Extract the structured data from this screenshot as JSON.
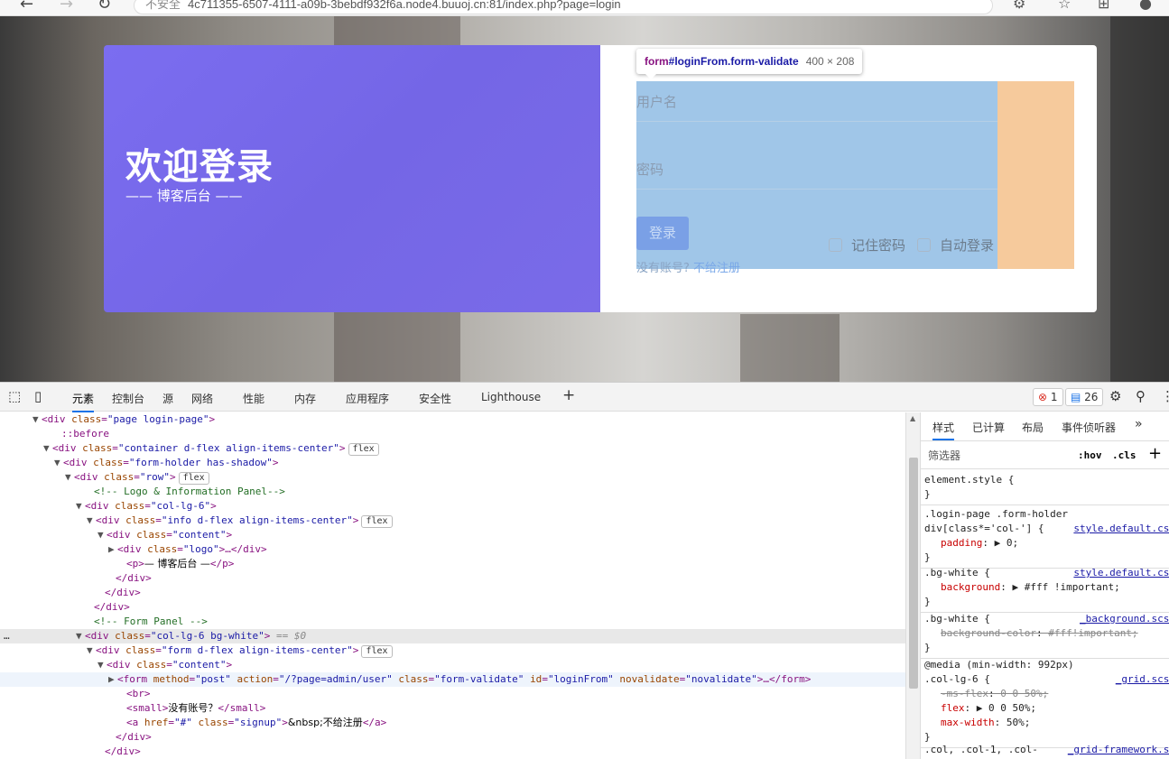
{
  "browser": {
    "back_icon": "←",
    "forward_icon": "→",
    "reload_icon": "↻",
    "security_label": "不安全",
    "url": "4c711355-6507-4111-a09b-3bebdf932f6a.node4.buuoj.cn:81/index.php?page=login"
  },
  "page": {
    "title": "欢迎登录",
    "subtitle": "—— 博客后台 ——",
    "username_placeholder": "用户名",
    "password_placeholder": "密码",
    "login_button": "登录",
    "remember_label": "记住密码",
    "autologin_label": "自动登录",
    "no_account": "没有账号?",
    "signup_link": "不给注册"
  },
  "tooltip": {
    "tag": "form",
    "selector": "#loginFrom.form-validate",
    "size": "400 × 208"
  },
  "devtools": {
    "tabs": [
      "元素",
      "控制台",
      "源",
      "网络",
      "性能",
      "内存",
      "应用程序",
      "安全性",
      "Lighthouse"
    ],
    "error_count": "1",
    "message_count": "26",
    "styles_tabs": [
      "样式",
      "已计算",
      "布局",
      "事件侦听器"
    ],
    "filter_placeholder": "筛选器",
    "hov": ":hov",
    "cls": ".cls",
    "dom_lines": [
      {
        "prefix": "▼",
        "t1": "<div ",
        "an": "class",
        "av": "\"page login-page\"",
        "t2": ">"
      },
      {
        "prefix": "",
        "ps": "::before"
      },
      {
        "prefix": "▼",
        "t1": "<div ",
        "an": "class",
        "av": "\"container d-flex align-items-center\"",
        "t2": ">",
        "flex": "flex"
      },
      {
        "prefix": "▼",
        "t1": "<div ",
        "an": "class",
        "av": "\"form-holder has-shadow\"",
        "t2": ">"
      },
      {
        "prefix": "▼",
        "t1": "<div ",
        "an": "class",
        "av": "\"row\"",
        "t2": ">",
        "flex": "flex"
      },
      {
        "prefix": "",
        "cm": "<!-- Logo & Information Panel-->"
      },
      {
        "prefix": "▼",
        "t1": "<div ",
        "an": "class",
        "av": "\"col-lg-6\"",
        "t2": ">"
      },
      {
        "prefix": "▼",
        "t1": "<div ",
        "an": "class",
        "av": "\"info d-flex align-items-center\"",
        "t2": ">",
        "flex": "flex"
      },
      {
        "prefix": "▼",
        "t1": "<div ",
        "an": "class",
        "av": "\"content\"",
        "t2": ">"
      },
      {
        "prefix": "▶",
        "t1": "<div ",
        "an": "class",
        "av": "\"logo\"",
        "t2": ">…</div>"
      },
      {
        "prefix": "",
        "t1": "<p>",
        "tx": "— 博客后台 —",
        "t2": "</p>"
      },
      {
        "prefix": "",
        "t1": "</div>"
      },
      {
        "prefix": "",
        "t1": "</div>"
      },
      {
        "prefix": "",
        "t1": "</div>"
      },
      {
        "prefix": "",
        "cm": "<!-- Form Panel    -->"
      },
      {
        "prefix": "▼",
        "t1": "<div ",
        "an": "class",
        "av": "\"col-lg-6 bg-white\"",
        "t2": ">",
        "eq": " == $0"
      },
      {
        "prefix": "▼",
        "t1": "<div ",
        "an": "class",
        "av": "\"form d-flex align-items-center\"",
        "t2": ">",
        "flex": "flex"
      },
      {
        "prefix": "▼",
        "t1": "<div ",
        "an": "class",
        "av": "\"content\"",
        "t2": ">"
      },
      {
        "prefix": "▶",
        "t1": "<form ",
        "an": "method",
        "av": "\"post\"",
        "an2": "action",
        "av2": "\"/?page=admin/user\"",
        "an3": "class",
        "av3": "\"form-validate\"",
        "an4": "id",
        "av4": "\"loginFrom\"",
        "an5": "novalidate",
        "av5": "\"novalidate\"",
        "t2": ">…</form>"
      },
      {
        "prefix": "",
        "t1": "<br>"
      },
      {
        "prefix": "",
        "t1": "<small>",
        "tx": "没有账号？",
        "t2": "</small>"
      },
      {
        "prefix": "",
        "t1": "<a ",
        "an": "href",
        "av": "\"#\"",
        "an2": "class",
        "av2": "\"signup\"",
        "t2": ">",
        "tx": "&nbsp;不给注册",
        "t3": "</a>"
      },
      {
        "prefix": "",
        "t1": "</div>"
      },
      {
        "prefix": "",
        "t1": "</div>"
      }
    ],
    "rules": [
      {
        "selector": "element.style {",
        "source": "",
        "lines": [
          "}"
        ]
      },
      {
        "selector": ".login-page .form-holder div[class*='col-'] {",
        "source": "style.default.css",
        "props": [
          {
            "name": "padding",
            "value": "▶ 0;",
            "struck": false
          }
        ]
      },
      {
        "selector": ".bg-white {",
        "source": "style.default.css",
        "props": [
          {
            "name": "background",
            "value": "▶ #fff !important;",
            "struck": false
          }
        ]
      },
      {
        "selector": ".bg-white {",
        "source": "_background.scss",
        "props": [
          {
            "name": "background-color",
            "value": "#fff!important;",
            "struck": true
          }
        ]
      },
      {
        "selector": ".col-lg-6 {",
        "media": "@media (min-width: 992px)",
        "source": "_grid.scss",
        "props": [
          {
            "name": "-ms-flex",
            "value": "0 0 50%;",
            "struck": true
          },
          {
            "name": "flex",
            "value": "▶ 0 0 50%;",
            "struck": false
          },
          {
            "name": "max-width",
            "value": "50%;",
            "struck": false
          }
        ]
      },
      {
        "selector": ".col, .col-1, .col-",
        "source": "_grid-framework.sc"
      }
    ]
  },
  "colors": {
    "panel_purple": "#7b6df0",
    "form_highlight": "#6fa8dc",
    "padding_highlight": "#f6ca9c",
    "devtools_accent": "#1a73e8"
  }
}
